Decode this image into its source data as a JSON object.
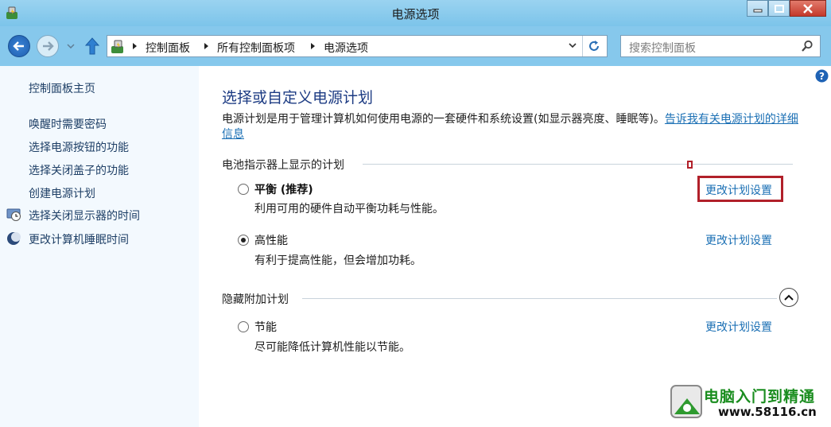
{
  "window": {
    "title": "电源选项"
  },
  "address": {
    "crumbs": [
      "控制面板",
      "所有控制面板项",
      "电源选项"
    ]
  },
  "search": {
    "placeholder": "搜索控制面板"
  },
  "sidebar": {
    "home": "控制面板主页",
    "links": [
      {
        "label": "唤醒时需要密码",
        "icon": ""
      },
      {
        "label": "选择电源按钮的功能",
        "icon": ""
      },
      {
        "label": "选择关闭盖子的功能",
        "icon": ""
      },
      {
        "label": "创建电源计划",
        "icon": ""
      },
      {
        "label": "选择关闭显示器的时间",
        "icon": "display-clock-icon"
      },
      {
        "label": "更改计算机睡眠时间",
        "icon": "moon-icon"
      }
    ]
  },
  "main": {
    "heading": "选择或自定义电源计划",
    "description": "电源计划是用于管理计算机如何使用电源的一套硬件和系统设置(如显示器亮度、睡眠等)。",
    "description_link": "告诉我有关电源计划的详细信息",
    "battery_section": "电池指示器上显示的计划",
    "plans": [
      {
        "name": "平衡 (推荐)",
        "desc": "利用可用的硬件自动平衡功耗与性能。",
        "selected": false,
        "link": "更改计划设置"
      },
      {
        "name": "高性能",
        "desc": "有利于提高性能，但会增加功耗。",
        "selected": true,
        "link": "更改计划设置"
      }
    ],
    "hidden_section": "隐藏附加计划",
    "hidden_plans": [
      {
        "name": "节能",
        "desc": "尽可能降低计算机性能以节能。",
        "selected": false,
        "link": "更改计划设置"
      }
    ]
  },
  "watermark": {
    "title": "电脑入门到精通",
    "url": "www.58116.cn"
  },
  "colors": {
    "title_bar": "#86c8ec",
    "link": "#1a6fb4",
    "heading": "#1c3b83",
    "highlight": "#b1202a"
  }
}
